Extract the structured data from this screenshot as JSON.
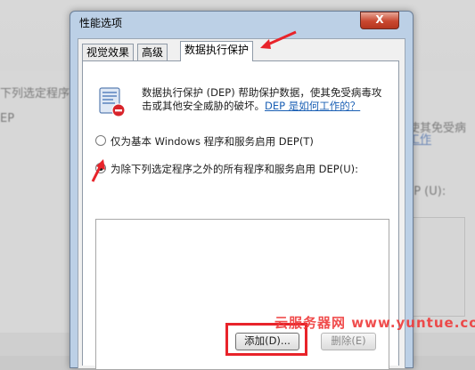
{
  "background": {
    "left_text_1": "下列选定程序",
    "left_text_2": "EP",
    "right_text_1": "使其免受病",
    "right_text_2": "工作",
    "right_text_3": "EP (U):"
  },
  "dialog": {
    "title": "性能选项",
    "close_label": "X",
    "tabs": [
      {
        "label": "视觉效果",
        "active": false
      },
      {
        "label": "高级",
        "active": false
      },
      {
        "label": "数据执行保护",
        "active": true
      }
    ],
    "description": "数据执行保护 (DEP) 帮助保护数据，使其免受病毒攻击或其他安全威胁的破坏。",
    "help_link": "DEP 是如何工作的？",
    "radio_options": [
      {
        "label": "仅为基本 Windows 程序和服务启用 DEP(T)",
        "checked": false
      },
      {
        "label": "为除下列选定程序之外的所有程序和服务启用 DEP(U):",
        "checked": true
      }
    ],
    "buttons": {
      "add": "添加(D)...",
      "remove": "删除(E)"
    }
  },
  "watermark": "云服务器网 www.yuntue.com",
  "colors": {
    "annotation_red": "#e8232a",
    "link_blue": "#1a5fb4",
    "title_bar": "#bcd0e6"
  }
}
